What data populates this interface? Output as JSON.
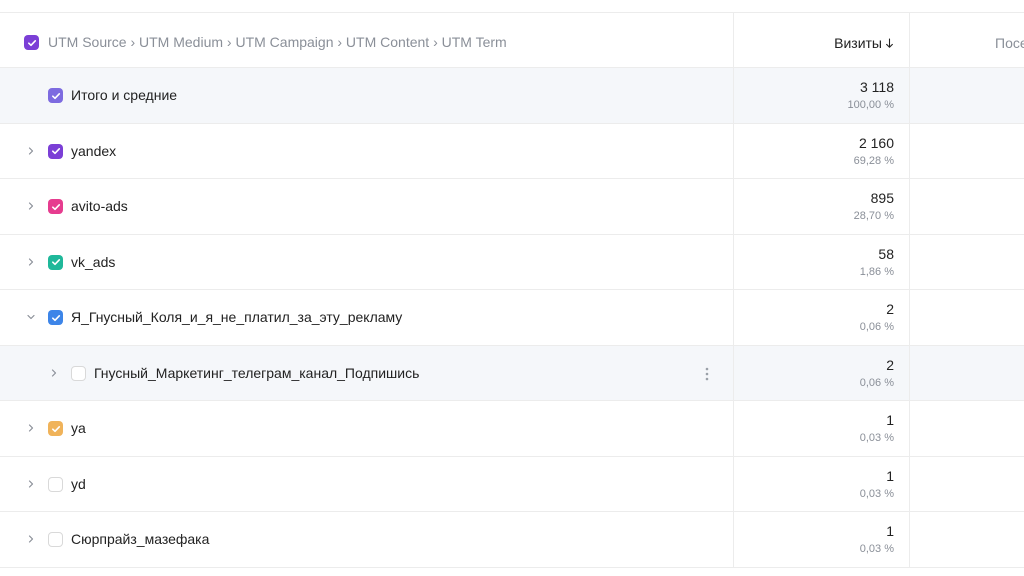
{
  "header": {
    "grouping_path": "UTM Source › UTM Medium › UTM Campaign › UTM Content › UTM Term",
    "visits_label": "Визиты",
    "next_col_label": "Посе",
    "checkbox_color": "#7b3fd6"
  },
  "rows": [
    {
      "label": "Итого и средние",
      "value": "3 118",
      "pct": "100,00 %",
      "color": "#7d6be0",
      "checked": true,
      "indent": 0,
      "arrow": "none",
      "shaded": true
    },
    {
      "label": "yandex",
      "value": "2 160",
      "pct": "69,28 %",
      "color": "#7b3fd6",
      "checked": true,
      "indent": 0,
      "arrow": "right",
      "shaded": false
    },
    {
      "label": "avito-ads",
      "value": "895",
      "pct": "28,70 %",
      "color": "#e63c8f",
      "checked": true,
      "indent": 0,
      "arrow": "right",
      "shaded": false
    },
    {
      "label": "vk_ads",
      "value": "58",
      "pct": "1,86 %",
      "color": "#1fb89a",
      "checked": true,
      "indent": 0,
      "arrow": "right",
      "shaded": false
    },
    {
      "label": "Я_Гнусный_Коля_и_я_не_платил_за_эту_рекламу",
      "value": "2",
      "pct": "0,06 %",
      "color": "#3d85e8",
      "checked": true,
      "indent": 0,
      "arrow": "down",
      "shaded": false
    },
    {
      "label": "Гнусный_Маркетинг_телеграм_канал_Подпишись",
      "value": "2",
      "pct": "0,06 %",
      "color": "",
      "checked": false,
      "indent": 1,
      "arrow": "right",
      "shaded": true,
      "kebab": true
    },
    {
      "label": "ya",
      "value": "1",
      "pct": "0,03 %",
      "color": "#f0b35a",
      "checked": true,
      "indent": 0,
      "arrow": "right",
      "shaded": false
    },
    {
      "label": "yd",
      "value": "1",
      "pct": "0,03 %",
      "color": "",
      "checked": false,
      "indent": 0,
      "arrow": "right",
      "shaded": false
    },
    {
      "label": "Сюрпрайз_мазефака",
      "value": "1",
      "pct": "0,03 %",
      "color": "",
      "checked": false,
      "indent": 0,
      "arrow": "right",
      "shaded": false
    }
  ]
}
